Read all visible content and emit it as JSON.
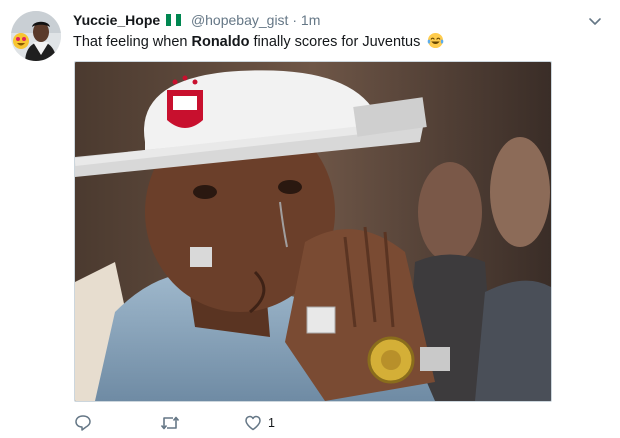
{
  "tweet": {
    "display_name": "Yuccie_Hope",
    "handle": "@hopebay_gist",
    "separator": "·",
    "timestamp": "1m",
    "text_before": "That feeling when ",
    "text_bold": "Ronaldo",
    "text_after": " finally scores for Juventus",
    "like_count": "1"
  },
  "icons": {
    "flag": "nigeria-flag-icon",
    "emoji": "crying-laughing-emoji-icon",
    "caret": "chevron-down-icon",
    "reply": "reply-icon",
    "retweet": "retweet-icon",
    "like": "heart-icon"
  },
  "colors": {
    "text": "#14171a",
    "secondary_text": "#657786",
    "border": "#ccd6dd",
    "flag_green": "#008751"
  }
}
